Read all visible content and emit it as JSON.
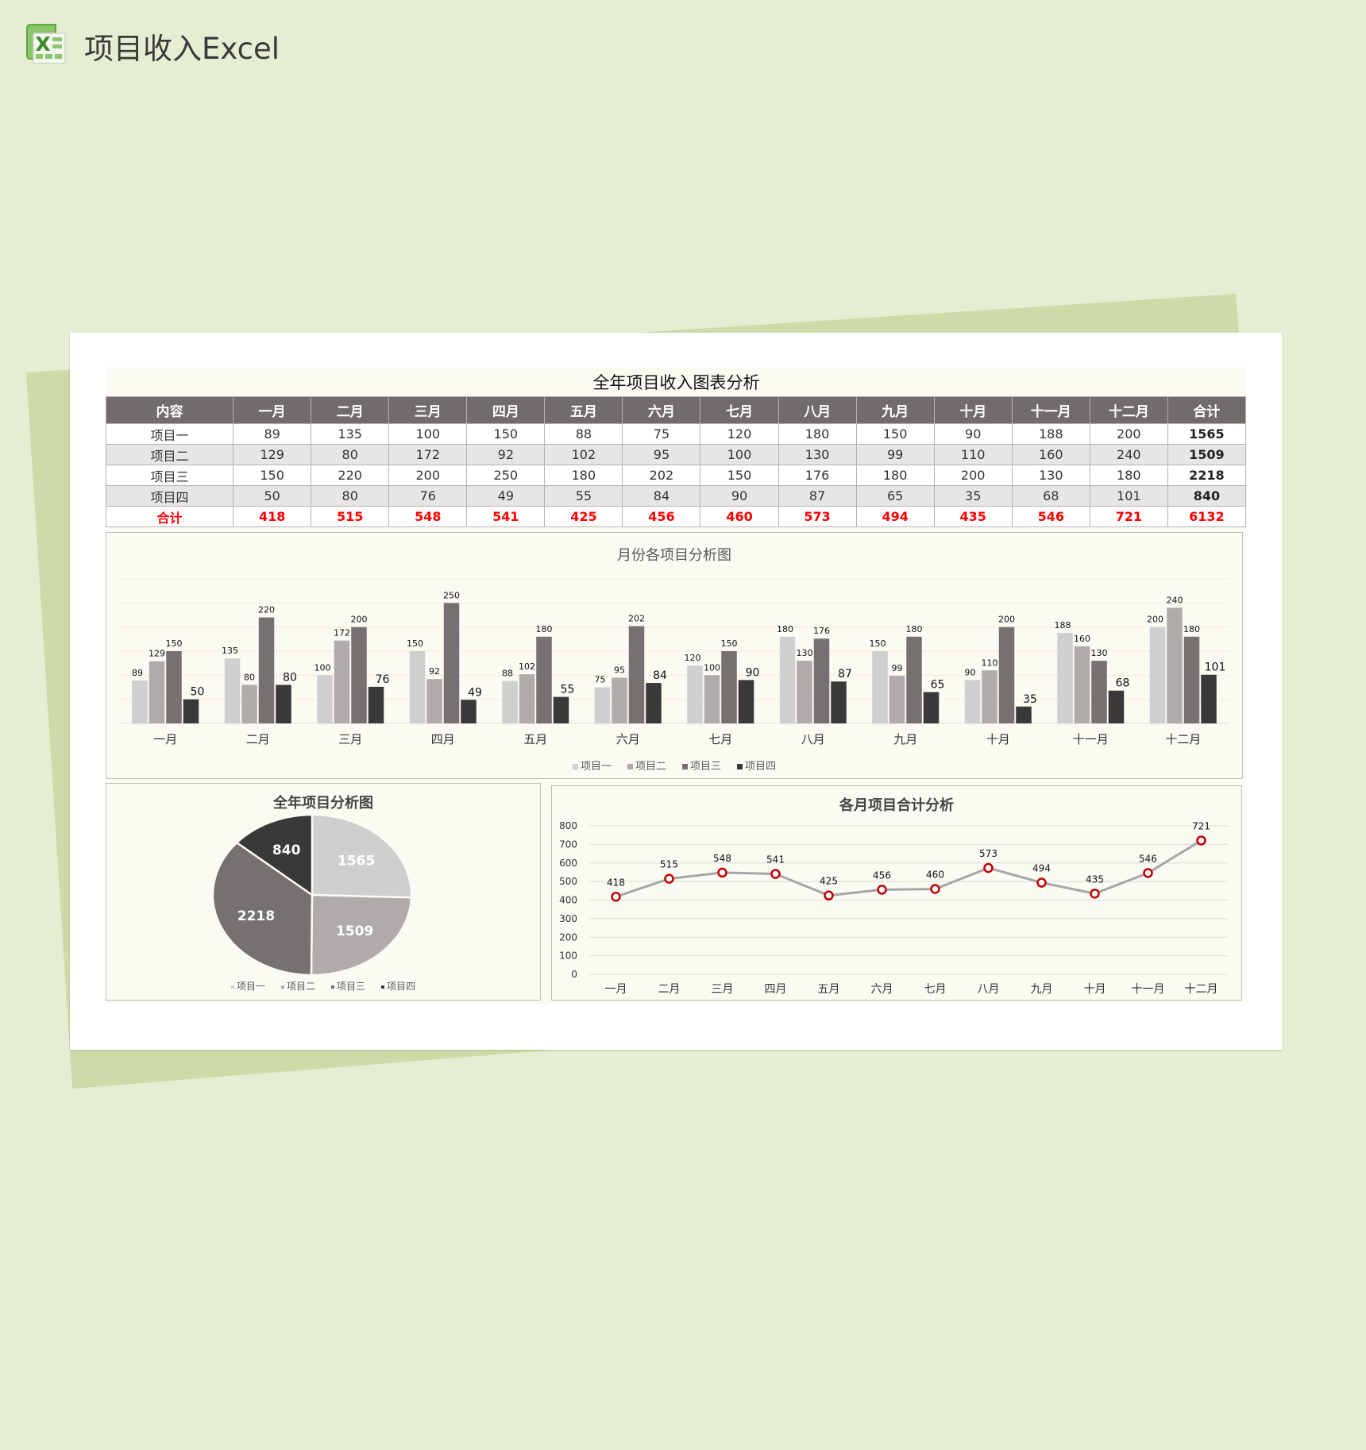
{
  "page": {
    "title": "项目收入Excel",
    "icon": "excel-icon"
  },
  "table": {
    "title": "全年项目收入图表分析",
    "headers": [
      "内容",
      "一月",
      "二月",
      "三月",
      "四月",
      "五月",
      "六月",
      "七月",
      "八月",
      "九月",
      "十月",
      "十一月",
      "十二月",
      "合计"
    ],
    "rows": [
      {
        "label": "项目一",
        "values": [
          89,
          135,
          100,
          150,
          88,
          75,
          120,
          180,
          150,
          90,
          188,
          200
        ],
        "total": 1565
      },
      {
        "label": "项目二",
        "values": [
          129,
          80,
          172,
          92,
          102,
          95,
          100,
          130,
          99,
          110,
          160,
          240
        ],
        "total": 1509
      },
      {
        "label": "项目三",
        "values": [
          150,
          220,
          200,
          250,
          180,
          202,
          150,
          176,
          180,
          200,
          130,
          180
        ],
        "total": 2218
      },
      {
        "label": "项目四",
        "values": [
          50,
          80,
          76,
          49,
          55,
          84,
          90,
          87,
          65,
          35,
          68,
          101
        ],
        "total": 840
      }
    ],
    "sum_row": {
      "label": "合计",
      "values": [
        418,
        515,
        548,
        541,
        425,
        456,
        460,
        573,
        494,
        435,
        546,
        721
      ],
      "total": 6132
    }
  },
  "colors": {
    "series": [
      "#d0cece",
      "#afabab",
      "#767171",
      "#3a3838"
    ],
    "header_bg": "#716b6b",
    "sum_text": "#ff0000",
    "line": "#a6a6a6",
    "marker": "#c00000"
  },
  "chart_data": [
    {
      "type": "bar",
      "title": "月份各项目分析图",
      "categories": [
        "一月",
        "二月",
        "三月",
        "四月",
        "五月",
        "六月",
        "七月",
        "八月",
        "九月",
        "十月",
        "十一月",
        "十二月"
      ],
      "series": [
        {
          "name": "项目一",
          "values": [
            89,
            135,
            100,
            150,
            88,
            75,
            120,
            180,
            150,
            90,
            188,
            200
          ]
        },
        {
          "name": "项目二",
          "values": [
            129,
            80,
            172,
            92,
            102,
            95,
            100,
            130,
            99,
            110,
            160,
            240
          ]
        },
        {
          "name": "项目三",
          "values": [
            150,
            220,
            200,
            250,
            180,
            202,
            150,
            176,
            180,
            200,
            130,
            180
          ]
        },
        {
          "name": "项目四",
          "values": [
            50,
            80,
            76,
            49,
            55,
            84,
            90,
            87,
            65,
            35,
            68,
            101
          ]
        }
      ],
      "ylim": [
        0,
        300
      ],
      "ytick_step": 50,
      "show_yaxis_labels": false,
      "grid": true,
      "legend": "bottom",
      "xlabel": "",
      "ylabel": ""
    },
    {
      "type": "pie",
      "title": "全年项目分析图",
      "labels": [
        "项目一",
        "项目二",
        "项目三",
        "项目四"
      ],
      "values": [
        1565,
        1509,
        2218,
        840
      ],
      "legend": "bottom"
    },
    {
      "type": "line",
      "title": "各月项目合计分析",
      "categories": [
        "一月",
        "二月",
        "三月",
        "四月",
        "五月",
        "六月",
        "七月",
        "八月",
        "九月",
        "十月",
        "十一月",
        "十二月"
      ],
      "series": [
        {
          "name": "合计",
          "values": [
            418,
            515,
            548,
            541,
            425,
            456,
            460,
            573,
            494,
            435,
            546,
            721
          ]
        }
      ],
      "ylim": [
        0,
        800
      ],
      "yticks": [
        0,
        100,
        200,
        300,
        400,
        500,
        600,
        700,
        800
      ],
      "grid": true,
      "legend": "none",
      "xlabel": "",
      "ylabel": ""
    }
  ]
}
